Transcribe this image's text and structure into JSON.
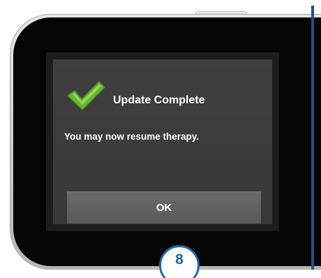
{
  "dialog": {
    "title": "Update Complete",
    "message": "You may now resume therapy.",
    "ok_label": "OK"
  },
  "callout": {
    "step_number": "8"
  },
  "icons": {
    "status_icon": "check-icon"
  },
  "colors": {
    "screen_background": "#3c3c3c",
    "button_background": "#5f5f5f",
    "text": "#ffffff",
    "check": "#7ac143",
    "callout": "#1f66a8"
  }
}
